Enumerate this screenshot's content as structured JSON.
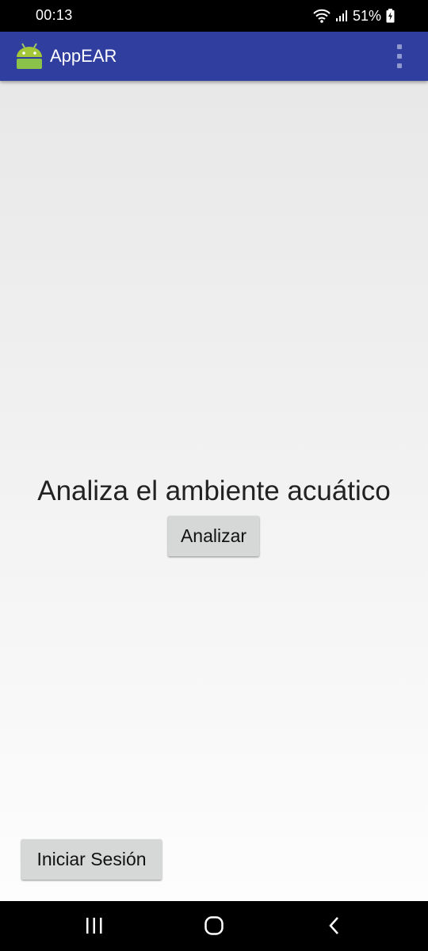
{
  "status_bar": {
    "time": "00:13",
    "battery": "51%",
    "icons": [
      "wifi-icon",
      "signal-icon",
      "battery-charging-icon"
    ]
  },
  "app_bar": {
    "title": "AppEAR",
    "logo_icon": "android-icon",
    "menu_icon": "more-vert-icon",
    "color": "#303F9F"
  },
  "main": {
    "headline": "Analiza el ambiente acuático",
    "analyze_button_label": "Analizar",
    "login_button_label": "Iniciar Sesión"
  },
  "nav_bar": {
    "icons": [
      "recent-apps-icon",
      "home-icon",
      "back-icon"
    ]
  }
}
